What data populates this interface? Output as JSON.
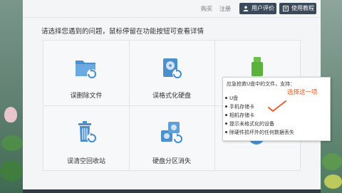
{
  "topbar": {
    "buy": "购买",
    "register": "注册",
    "user_review": "用户评价",
    "tutorial": "使用教程"
  },
  "headline": "请选择您遇到的问题，鼠标停留在功能按钮可查看详情",
  "cells": [
    {
      "label": "误删除文件",
      "icon": "folder-recover-icon"
    },
    {
      "label": "误格式化硬盘",
      "icon": "harddisk-recover-icon"
    },
    {
      "label": "",
      "icon": "usb-recover-icon"
    },
    {
      "label": "误清空回收站",
      "icon": "recycle-bin-icon"
    },
    {
      "label": "硬盘分区消失",
      "icon": "partition-recover-icon"
    },
    {
      "label": "",
      "icon": "recover-icon"
    }
  ],
  "tooltip": {
    "title": "应急抢救U盘中的文件，支持：",
    "items": [
      "U盘",
      "手机存储卡",
      "相机存储卡",
      "提示未格式化的设备",
      "除硬件损坏外的任何数据丢失"
    ],
    "annotation": "选择这一项"
  },
  "colors": {
    "accent": "#3f8fd2",
    "annotation": "#e8612c",
    "button": "#3b4a5a"
  }
}
